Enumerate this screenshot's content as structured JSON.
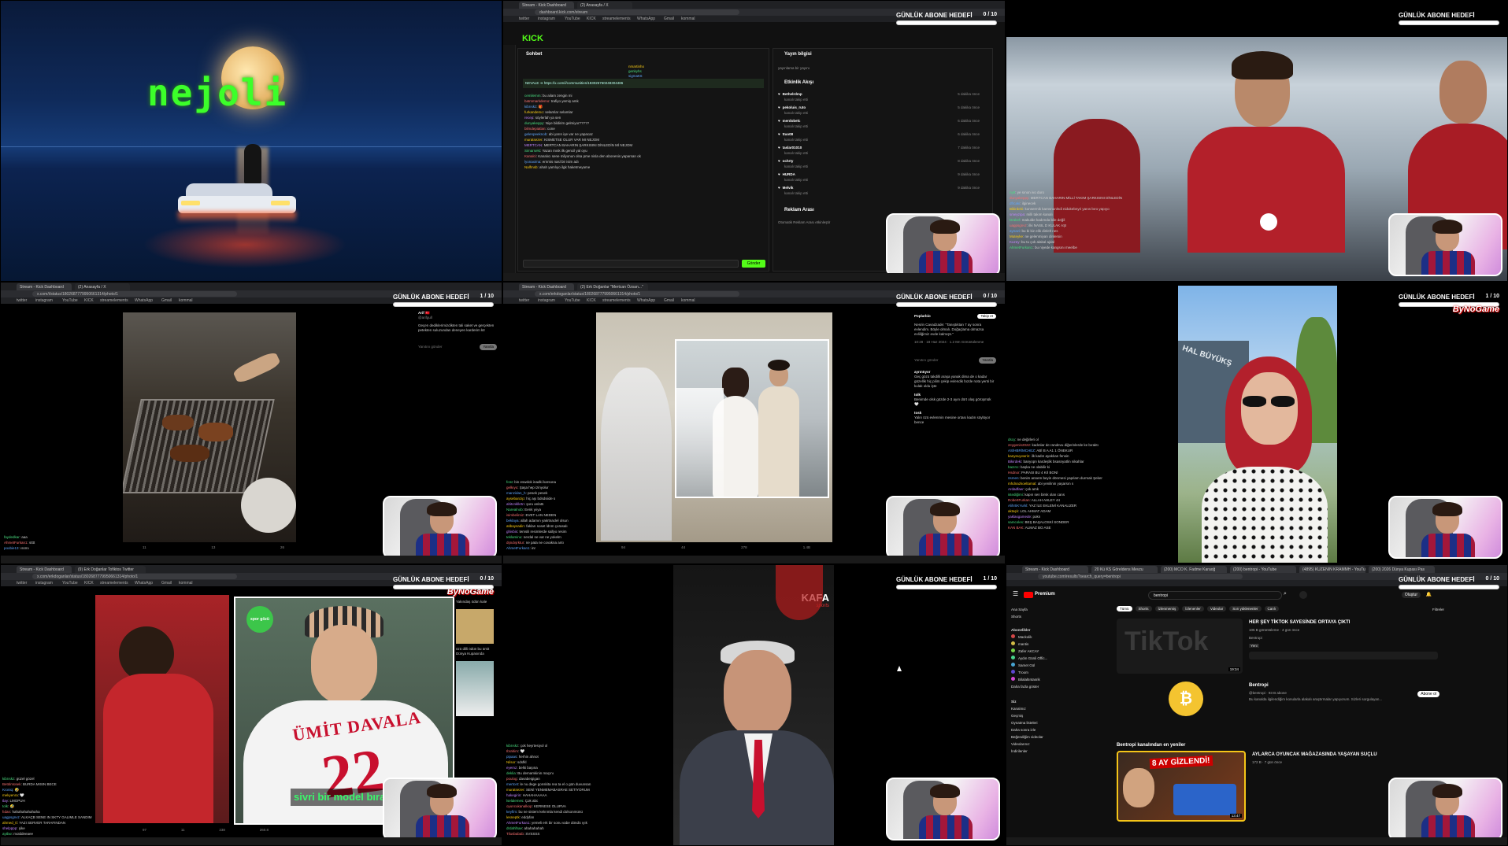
{
  "overlay": {
    "goal_title": "GÜNLÜK ABONE HEDEFİ",
    "goal_counts": [
      "0 / 10",
      "0 / 10",
      "",
      "1 / 10",
      "0 / 10",
      "1 / 10",
      "0 / 10",
      "1 / 10",
      "0 / 10"
    ],
    "brand": "ByNoGame"
  },
  "tile1": {
    "title_text": "nejoli"
  },
  "tile2": {
    "tabs": [
      "Stream - Kick Dashboard",
      "(2) Anasayfa / X"
    ],
    "url": "dashboard.kick.com/stream",
    "bookmarks": [
      "twitter",
      "instagram",
      "YouTube",
      "KICK",
      "streamelements",
      "WhatsApp",
      "Gmail",
      "kommal"
    ],
    "logo": "KICK",
    "chat_header": "Sohbet",
    "stream_info_header": "Yayın bilgisi",
    "stream_info_sub": "yayınlama bir yayını",
    "activity_header": "Etkinlik Akışı",
    "ad_header": "Reklam Arası",
    "ad_text": "Otomatik Reklam Arası etkinleştir",
    "pinned": [
      "NEVALE ➜ https://x.com/i/communities/183025760248304486"
    ],
    "chat_messages": [
      {
        "user": "cemilemm",
        "text": "bu ailam zengin mi"
      },
      {
        "user": "batmmarkdemo",
        "text": "trafiyo yemiş amk"
      },
      {
        "user": "kibrıskz",
        "text": "🎁"
      },
      {
        "user": "furkandemo",
        "text": "selamlar selamlar"
      },
      {
        "user": "recep",
        "text": "söylerlah ya sen"
      },
      {
        "user": "dunyakeppy",
        "text": "Niye bildirim gelmiyor?????"
      },
      {
        "user": "bilmdepiatlan",
        "text": "cone"
      },
      {
        "user": "gelenpeeknob",
        "text": "abi yarın işe var ne yapacaz"
      },
      {
        "user": "muratsezer",
        "text": "KISMETSE OLUR VAR MI NEJOM"
      },
      {
        "user": "MERTCAN",
        "text": "MERTCAN BAHARIN ŞARKISINI DİNLEDİN Mİ NEJOM"
      },
      {
        "user": "Simarsekt",
        "text": "Yazan mısk ilk gencil yal oyu"
      },
      {
        "user": "Kanalci",
        "text": "Kanalıcı sene milyonun olsa pme nisla den abonenis yaparsan ok"
      },
      {
        "user": "lyonaxima",
        "text": "ernmis nasl bir isim adı"
      },
      {
        "user": "Nalfmsb",
        "text": "ahah yamlıyo ilgk haketmeyame"
      }
    ],
    "viewers": [
      "nmartinho",
      "genkyhs",
      "sigmaK6"
    ],
    "activity": [
      {
        "user": "Bethelrdmp",
        "event": "kanalı takip etti",
        "time": "5 dakika önce"
      },
      {
        "user": "pekoluis_ruto",
        "event": "kanalı takip etti",
        "time": "5 dakika önce"
      },
      {
        "user": "merdobelc",
        "event": "kanalı takip etti",
        "time": "6 dakika önce"
      },
      {
        "user": "ttuo08",
        "event": "kanalı takip etti",
        "time": "6 dakika önce"
      },
      {
        "user": "taslar01010",
        "event": "kanalı takip etti",
        "time": "7 dakika önce"
      },
      {
        "user": "ochrty",
        "event": "kanalı takip etti",
        "time": "8 dakika önce"
      },
      {
        "user": "HURDA",
        "event": "kanalı takip etti",
        "time": "9 dakika önce"
      },
      {
        "user": "Melvik",
        "event": "kanalı takip etti",
        "time": "9 dakika önce"
      }
    ],
    "send_button": "Gönder"
  },
  "tile3": {
    "chat_lines": [
      {
        "user": "ny9",
        "text": "ye sınon ivo duro"
      },
      {
        "user": "dunyakeppy",
        "text": "MERTCAN BAHARIN MİLLİ TAKIM ŞARKISINI DİNLEDİN"
      },
      {
        "user": "dfrcaki",
        "text": "ilginecek"
      },
      {
        "user": "Bikirdeki",
        "text": "konsermik karnsnunlndi nidukebnyri yanıs bıro yapıyo"
      },
      {
        "user": "smeyzipa",
        "text": "milli takım kanalı"
      },
      {
        "user": "Drakef",
        "text": "makulde kadımda bile değil"
      },
      {
        "user": "uagpsgnvz",
        "text": "ilki NASIL D KULAK AŞI"
      },
      {
        "user": "aynazi",
        "text": "bu bi kiz elik dinlelt nes"
      },
      {
        "user": "Muteyke",
        "text": "ne gelenmiyan dinlersin"
      },
      {
        "user": "Kuzey",
        "text": "bu tu çok alakal ajdal"
      },
      {
        "user": "AhmetFurkan1",
        "text": "bu niyede kangsını meelbe"
      }
    ]
  },
  "tile4": {
    "tabs": [
      "Stream - Kick Dashboard",
      "(2) Anasayfa / X"
    ],
    "url": "x.com/i/status/1802687779950661314/photo/1",
    "bookmarks": [
      "twitter",
      "instagram",
      "YouTube",
      "KICK",
      "streamelements",
      "WhatsApp",
      "Gmail",
      "kommal"
    ],
    "post_author": "Arif 🇹🇷",
    "post_handle": "@arifgull",
    "post_text": "Geçen dediklerimizdikten tali saket ve gerçekten petekten suluzundan deneyen karderim ktr",
    "reply_placeholder": "Yanıtını gönder",
    "reply_button": "Yanıtla",
    "chat_lines": [
      {
        "user": "faydedkar",
        "text": "aaa"
      },
      {
        "user": "AhmetFurkan1",
        "text": "stttt"
      },
      {
        "user": "poobie13",
        "text": "ıssmı"
      }
    ],
    "stats": [
      "11",
      "13",
      "26"
    ]
  },
  "tile5": {
    "tabs": [
      "Stream - Kick Dashboard",
      "(2) Erk Doğanlar \"Mertcan Özsan...\""
    ],
    "url": "x.com/erkdoganlar/status/1802687779950661314/photo/1",
    "bookmarks": [
      "twitter",
      "instagram",
      "YouTube",
      "KICK",
      "streamelements",
      "WhatsApp",
      "Gmail",
      "kommal"
    ],
    "post_author": "Poplarbio",
    "follow_button": "Takip et",
    "post_text": "Nesrin Cavadzade: \"Tanıştıktan 7 ay sonra evlendim. Böyle olmalı. Doğaçlama olmazsa evliliğimiz evde kalmıştı.\"",
    "post_meta": "10:28 · 18 Haz 2024 · 1.2 Mn Görüntülenme",
    "reply_placeholder": "Yanıtını gönder",
    "reply_button": "Yanıtla",
    "replies": [
      {
        "user": "ayrıntıyor",
        "text": "Geç gözü takdilli araşa yanak dima de o kadar güzellik hiç pilim çekip evlendik bızde nota yenti bir kulak oldu işte"
      },
      {
        "user": "tolk",
        "text": "Benimde olsk gözde 2-3 ayın dört olaş görüşmük 🤍"
      },
      {
        "user": "tosk",
        "text": "Yalın özü evlenmin mesine ortası kadın söylüyor bence"
      }
    ],
    "chat_lines": [
      {
        "user": "fırat",
        "text": "bin eswdok inadki karsona"
      },
      {
        "user": "gelkıyo",
        "text": "Şaşa hep izinyolur"
      },
      {
        "user": "manzidan_h",
        "text": "pesek pesek"
      },
      {
        "user": "aysebanzip",
        "text": "hiç aşı bdsdsiide s"
      },
      {
        "user": "ahitcnklkrtn",
        "text": "şoru anlattı"
      },
      {
        "user": "Narealnob",
        "text": "Eenk yıiya"
      },
      {
        "user": "isimbelirsiz",
        "text": "EVET LAN NEDEN"
      },
      {
        "user": "beklaya",
        "text": "allah adamın yakrtnaclel olsun"
      },
      {
        "user": "atibaysadin",
        "text": "fakları soset ldnm çorasalı"
      },
      {
        "user": "ghivbis",
        "text": "temsili resimlerde sallyo resim"
      },
      {
        "user": "teklaminu",
        "text": "nerdal ne var ne yokelm"
      },
      {
        "user": "dşndışrktur",
        "text": "ne pata ne covakna antı"
      },
      {
        "user": "AhmetFurkan1",
        "text": "inr"
      }
    ],
    "stats": [
      "94",
      "44",
      "278",
      "1.4B"
    ]
  },
  "tile6": {
    "chat_lines": [
      {
        "user": "dscy",
        "text": "ne değirleri ol"
      },
      {
        "user": "zeygenin2022",
        "text": "kadınlar de randevu diğerinlerde ke bıraktı"
      },
      {
        "user": "ASİHBRİMCHEZ",
        "text": "ABİ B A A1 1 ÖNEKUR"
      },
      {
        "user": "kanyeuyvwrin",
        "text": "ilk kadın ayaklıan fensin"
      },
      {
        "user": "Bikirdeki",
        "text": "banyopn kardeşlik bsasnyatlin nikahlar"
      },
      {
        "user": "hazırcı",
        "text": "başka ne olabilir ki"
      },
      {
        "user": "Hsdnor",
        "text": "PARASI BU 4 KIİ BONİ"
      },
      {
        "user": "ösmen",
        "text": "benim annem beyin dönmesi yapılam durmak Şeker"
      },
      {
        "user": "mhdnazkoeltamal",
        "text": "abi yenilinin yaşarsın s"
      },
      {
        "user": "Ardadfaer",
        "text": "çok amk"
      },
      {
        "user": "istediğimi",
        "text": "kapın sen birsk olan cans"
      },
      {
        "user": "RobertFurkan",
        "text": "ALLAH AHLEY 44"
      },
      {
        "user": "AlihrtiKYurkl",
        "text": "YAZ İLE EKLEMİ KANALIZER"
      },
      {
        "user": "aktaşlı",
        "text": "LOL AHMAT ADAM"
      },
      {
        "user": "yaklasgamede",
        "text": "pokn"
      },
      {
        "user": "samcoles",
        "text": "BEŞ BAŞALOSKİ SONDER"
      },
      {
        "user": "KAN BAK",
        "text": "ALMAZ BO ASE"
      }
    ],
    "building_text": "HAL BÜYÜKŞ"
  },
  "tile7": {
    "tabs": [
      "Stream - Kick Dashboard",
      "(9) Erk Doğanlar Tofiktos Twitter"
    ],
    "url": "x.com/erkdoganlar/status/1802687779950661314/photo/1",
    "bookmarks": [
      "twitter",
      "instagram",
      "YouTube",
      "KICK",
      "streamelements",
      "WhatsApp",
      "Gmail",
      "kommal"
    ],
    "jersey_name": "ÜMİT DAVALA",
    "jersey_number": "22",
    "caption": "sivri bir model bıra",
    "logo_text": "spor gözü",
    "side_text": "Yakındaş ödün kale",
    "side_text2": "özü dilli ödün bu ümit Dünya Kupasında",
    "chat_lines": [
      {
        "user": "kibrıskz",
        "text": "güzel gözel"
      },
      {
        "user": "Betülmüsek",
        "text": "BURDA MISIN BECE"
      },
      {
        "user": "Kroniq",
        "text": "🤣"
      },
      {
        "user": "mekyenra",
        "text": "🤍"
      },
      {
        "user": "tlay",
        "text": "LMOPUH"
      },
      {
        "user": "tolk",
        "text": "🤣"
      },
      {
        "user": "fıdan",
        "text": "hahahahahahaha"
      },
      {
        "user": "uagpsgnvz",
        "text": "ALKAÇB SENE IN SKTY GALIMLE SANDIM"
      },
      {
        "user": "ahmed_tİ",
        "text": "YAZI SERVER TARAFINDAN"
      },
      {
        "user": "shelpppp",
        "text": "şike"
      },
      {
        "user": "aytbw",
        "text": "moiddeeaee"
      },
      {
        "user": "arzdadaaatarz",
        "text": "yaas yuzr ad hasdarlılık saatıs esrleyl arkesir lk"
      }
    ],
    "stats": [
      "97",
      "11",
      "238",
      "260.8"
    ]
  },
  "tile8": {
    "watermark": "KAFA",
    "watermark_sub": "sports",
    "chat_lines": [
      {
        "user": "kibrıskz",
        "text": "çok heyrtesiyol ol"
      },
      {
        "user": "Ibrahim",
        "text": "🤍"
      },
      {
        "user": "pipaas",
        "text": "herhin ahnot"
      },
      {
        "user": "Nilsor",
        "text": "sdsfkl"
      },
      {
        "user": "eyemz",
        "text": "belki başına"
      },
      {
        "user": "deklia",
        "text": "Bu demamkinin maçını"
      },
      {
        "user": "poulog",
        "text": "davabeigigan"
      },
      {
        "user": "mertcet",
        "text": "le nu dege gonskita rea ta el o gün duvunsan"
      },
      {
        "user": "muratsezer",
        "text": "SENİ YENMEMABASRAE SETIYORUM"
      },
      {
        "user": "hakegirin",
        "text": "HAHAHAAAAA"
      },
      {
        "user": "lselalemes",
        "text": "Çok abc"
      },
      {
        "user": "oyuncukanalkop",
        "text": "KERNESE OLURVA"
      },
      {
        "user": "keyfim",
        "text": "bu ne sistem kelınmla kendi dolsonmünü"
      },
      {
        "user": "lesneptk",
        "text": "eddyfan"
      },
      {
        "user": "AhmetFurkan1",
        "text": "yemeli erk bir sonu vabe döndü ıyık"
      },
      {
        "user": "drdahlhae",
        "text": "ahahahahah"
      },
      {
        "user": "Tilusbabab",
        "text": "SVSSSS"
      }
    ]
  },
  "tile9": {
    "tabs": [
      "Stream - Kick Dashboard",
      "20 Kü KS Göreldens Mevzu",
      "(200) MCO K. Fadme Karaoğ",
      "(200) bentropi - YouTube",
      "(4895) KUZENIN KRAMMH - YouTu",
      "(200) 2026 Dünya Kupası Pas"
    ],
    "url": "youtube.com/results?search_query=bentropi",
    "search_value": "bentropi",
    "premium_label": "Premium",
    "chips": [
      "Tümü",
      "Shorts",
      "İzlenmemiş",
      "İzlenenler",
      "Videolar",
      "Son yüklenenler",
      "Canlı"
    ],
    "filters_label": "Filtreler",
    "upload_button": "Oluştur",
    "sidebar_top": [
      "Ana Sayfa",
      "Shorts"
    ],
    "subs_header": "Abonelikler",
    "subs": [
      "Mackolik",
      "mantis",
      "Zafer AKCAY",
      "Aydın Günli Offic...",
      "Samet Gül",
      "Troom",
      "Bilalaltıntasrik"
    ],
    "show_more": "Daha fazla göster",
    "you_header": "Siz",
    "you_items": [
      "Kanalınız",
      "Geçmiş",
      "Oynatma listeleri",
      "Daha sonra izle",
      "Beğendiğim videolar",
      "Videolarınız",
      "İndirilenler"
    ],
    "video1_title": "HER ŞEY TİKTOK SAYESİNDE ORTAYA ÇIKTI",
    "video1_meta": "105 B görüntüleme · 4 gün önce",
    "video1_channel": "Bentropi",
    "video1_duration": "19:34",
    "channel_name": "Bentropi",
    "channel_handle": "@bentropi · 93 B abone",
    "channel_desc": "Bu kanalda ilgilendiğim konularla alakalı araştırmalar yapıyorum. Sizleri sorgulayan...",
    "subscribe_button": "Abone ol",
    "channel_section": "Bentropi kanalından en yeniler",
    "video2_title": "AYLARCA OYUNCAK MAĞAZASINDA YAŞAYAN SUÇLU",
    "video2_meta": "172 B · 7 gün önce",
    "video2_badge": "8 AY GİZLENDİ!",
    "video2_duration": "13:47",
    "thumb_text": "TikTok",
    "new_label": "Yeni"
  }
}
